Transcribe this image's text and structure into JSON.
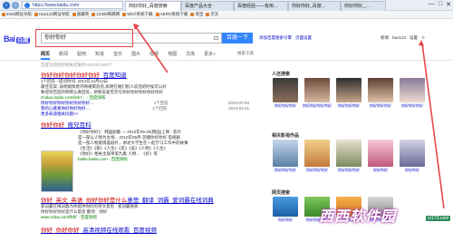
{
  "browser": {
    "url": "https://www.baidu.com/",
    "tabs": [
      "你好你好_百度搜索",
      "百度产品大全",
      "百度经验——有用…",
      "你好你好_百度…",
      "你好你好_..."
    ],
    "favorites": [
      "2345网址导航",
      "Hao123网址导航",
      "收藏夹",
      "12306铁路网",
      "Win7系统下载",
      "AERO系统下载",
      "淘宝",
      "京东"
    ],
    "controls": [
      "—",
      "□",
      "✕"
    ]
  },
  "search": {
    "logo_text": "Bai",
    "logo_badge": "百度",
    "query": "你好你好",
    "placeholder": "你好你好",
    "button_label": "百度一下",
    "top_links": [
      "添加百度搜索引擎",
      "页面设置"
    ],
    "user_links": [
      "新闻",
      "hao123",
      "设置"
    ],
    "nav_tabs": [
      "网页",
      "新闻",
      "贴吧",
      "知道",
      "音乐",
      "图片",
      "视频",
      "地图",
      "文库",
      "更多»"
    ],
    "tool_label": "搜索工具",
    "stats": "百度为您找到相关结果约100,000,000个"
  },
  "results": [
    {
      "title_pre": "",
      "title_hl": "你好你好你好你好你好",
      "title_post": "_百度知道",
      "lines": [
        "1个回答 - 提问时间: 2013年12月13日",
        "最佳答案: 表明观情者内隙绪窦悲伤,表明在她们别人说话的时候可以好",
        "象得到百度的明明认真回答，想要说爱无奈写你好你好你好你好你好"
      ],
      "url": "zhidao.baidu.com/link?... - 百度快照",
      "kv": [
        [
          "你好你好你好你好你好你好…",
          "1个回答",
          "2014-07-04"
        ],
        [
          "我的心跳真你好你好你好 …",
          "1个回答",
          "2014-04-11"
        ]
      ],
      "more": "更多知道相关问题>>"
    },
    {
      "title_pre": "你好你好",
      "title_hl": "",
      "title_post": "_搜兄百科",
      "lines": [
        "《你好你好》：韩国剧集 — 2010年09-20(韩国)上映 · 影片",
        "是一部以人物为主线... 2010年09月·首播你好你好·电视剧",
        "是一部人物爱情喜剧片，讲述大学生在一起学习工作中的故事",
        "《生活》《家》《人生》《友》《美》《人物》《人生》",
        "《你好》相关主旋律第九集 人物… 《好》等"
      ],
      "url": "baike.baidu.com - 百度快照"
    },
    {
      "title_pre": "你好_英文_英语_你好你好是什么",
      "title_hl": "",
      "title_post": "意思_翻译_词霸_爱词霸在线词典",
      "lines": [
        "爱词霸在线词典为你提供你好的英文意思 · 爱词霸搜索 ·",
        "你好你好你好是什么意思 翻译：你好"
      ],
      "url": "www.iciba.com/你好 - 百度快照"
    },
    {
      "title_pre": "你好_你好你好",
      "title_hl": "",
      "title_post": "_高清视频在线观看_百度视频",
      "lines": [],
      "url": ""
    }
  ],
  "sidebar": {
    "people_title": "人还搜索",
    "people": [
      "你好你好你好",
      "你好你好你好你好",
      "你好你好你好",
      "你好你好你好",
      "你好你好你好"
    ],
    "movies_title": "相关影视作品",
    "movies": [
      "你好你好你好",
      "你好你好你好",
      "你好你好你好",
      "你好你好",
      "你好你好"
    ],
    "apps_title": "网页搜索",
    "apps": [
      "你好你好",
      "你好你好你好",
      "你好你好",
      "你好你好你好"
    ]
  },
  "watermark": "西西软件园",
  "watermark_small": "cr173.com",
  "colors": {
    "accent": "#3385ff",
    "link": "#0000cc",
    "highlight": "#c00000",
    "annotation": "#e8474a"
  }
}
